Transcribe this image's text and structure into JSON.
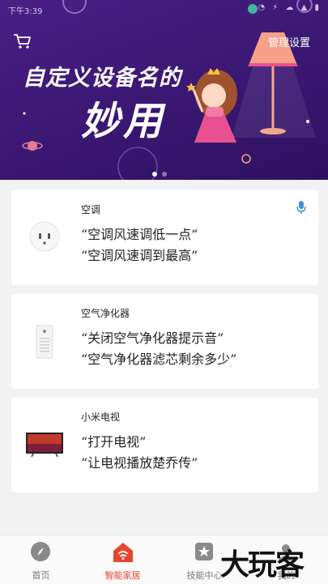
{
  "status_bar": {
    "time": "下午3:39",
    "icons": "◔ ⚡ ☁ ▲ ▮"
  },
  "banner": {
    "manage_label": "管理设置",
    "headline_line1": "自定义设备名的",
    "headline_line2": "妙用",
    "carousel": {
      "page_count": 2,
      "active_index": 0
    },
    "colors": {
      "background": "#3a1772",
      "accent_pink": "#e8508f",
      "lamp": "#f6a089"
    }
  },
  "devices": [
    {
      "name": "空调",
      "icon": "air-conditioner-socket-icon",
      "commands": [
        "“空调风速调低一点”",
        "“空调风速调到最高”"
      ],
      "has_mic": true
    },
    {
      "name": "空气净化器",
      "icon": "air-purifier-icon",
      "commands": [
        "“关闭空气净化器提示音”",
        "“空气净化器滤芯剩余多少”"
      ],
      "has_mic": false
    },
    {
      "name": "小米电视",
      "icon": "tv-icon",
      "commands": [
        "“打开电视”",
        "“让电视播放楚乔传”"
      ],
      "has_mic": false
    }
  ],
  "tabbar": {
    "active_index": 1,
    "active_color": "#e5462f",
    "tabs": [
      {
        "label": "首页",
        "icon": "compass-icon"
      },
      {
        "label": "智能家居",
        "icon": "smart-home-icon"
      },
      {
        "label": "技能中心",
        "icon": "star-badge-icon"
      },
      {
        "label": "我的",
        "icon": "profile-icon"
      }
    ]
  },
  "watermark": "大玩客"
}
